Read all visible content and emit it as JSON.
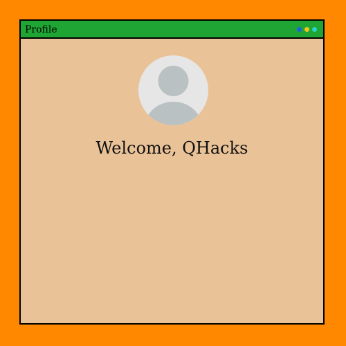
{
  "window": {
    "title": "Profile",
    "controls": [
      {
        "name": "blue-dot",
        "color": "#1e63d4"
      },
      {
        "name": "yellow-dot",
        "color": "#f0c419"
      },
      {
        "name": "cyan-dot",
        "color": "#26d3c4"
      }
    ]
  },
  "profile": {
    "avatar_icon": "user-avatar-icon",
    "welcome_text": "Welcome, QHacks"
  },
  "colors": {
    "page_background": "#ff8800",
    "window_background": "#eac297",
    "titlebar": "#1fa533",
    "avatar_background": "#e6e6e6",
    "avatar_figure": "#b9c1c2"
  }
}
